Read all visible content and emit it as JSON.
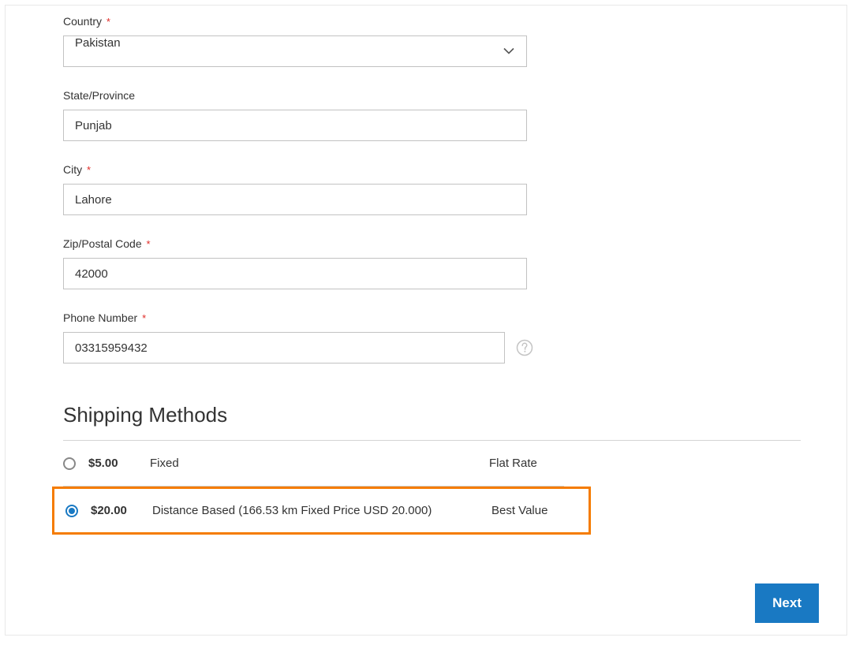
{
  "fields": {
    "country": {
      "label": "Country",
      "required": true,
      "value": "Pakistan"
    },
    "state": {
      "label": "State/Province",
      "required": false,
      "value": "Punjab"
    },
    "city": {
      "label": "City",
      "required": true,
      "value": "Lahore"
    },
    "zip": {
      "label": "Zip/Postal Code",
      "required": true,
      "value": "42000"
    },
    "phone": {
      "label": "Phone Number",
      "required": true,
      "value": "03315959432"
    }
  },
  "shipping": {
    "title": "Shipping Methods",
    "methods": [
      {
        "price": "$5.00",
        "method": "Fixed",
        "carrier": "Flat Rate",
        "selected": false
      },
      {
        "price": "$20.00",
        "method": "Distance Based (166.53 km Fixed Price USD 20.000)",
        "carrier": "Best Value",
        "selected": true
      }
    ]
  },
  "buttons": {
    "next": "Next"
  },
  "required_mark": "*"
}
